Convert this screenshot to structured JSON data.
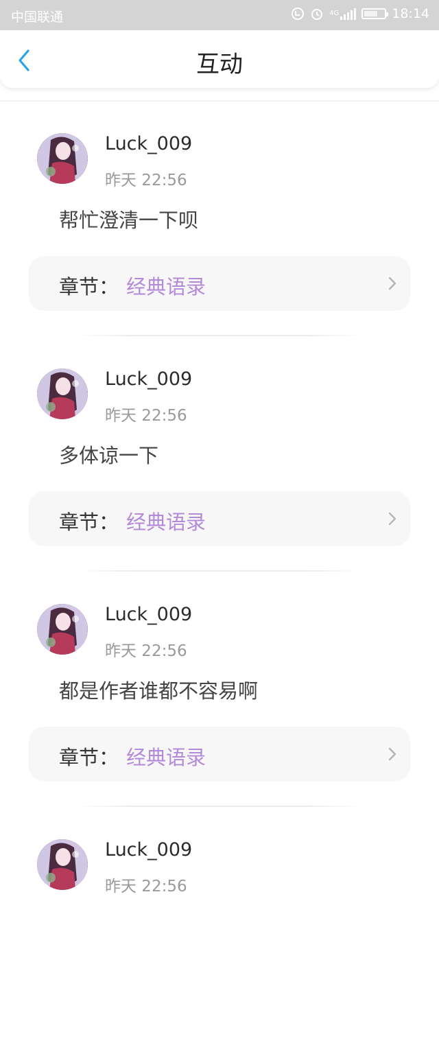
{
  "status_bar": {
    "carrier": "中国联通",
    "network": "4G",
    "time": "18:14",
    "icons": [
      "data-saver-icon",
      "alarm-icon",
      "signal-icon",
      "battery-icon"
    ]
  },
  "header": {
    "title": "互动",
    "back_icon": "chevron-left-icon"
  },
  "colors": {
    "accent": "#2aa3e6",
    "chapter_value": "#b28ad8"
  },
  "comments": [
    {
      "username": "Luck_009",
      "time": "昨天 22:56",
      "content": "帮忙澄清一下呗",
      "chapter_label": "章节：",
      "chapter_name": "经典语录"
    },
    {
      "username": "Luck_009",
      "time": "昨天 22:56",
      "content": "多体谅一下",
      "chapter_label": "章节：",
      "chapter_name": "经典语录"
    },
    {
      "username": "Luck_009",
      "time": "昨天 22:56",
      "content": "都是作者谁都不容易啊",
      "chapter_label": "章节：",
      "chapter_name": "经典语录"
    },
    {
      "username": "Luck_009",
      "time": "昨天 22:56",
      "content": "",
      "chapter_label": "",
      "chapter_name": ""
    }
  ]
}
